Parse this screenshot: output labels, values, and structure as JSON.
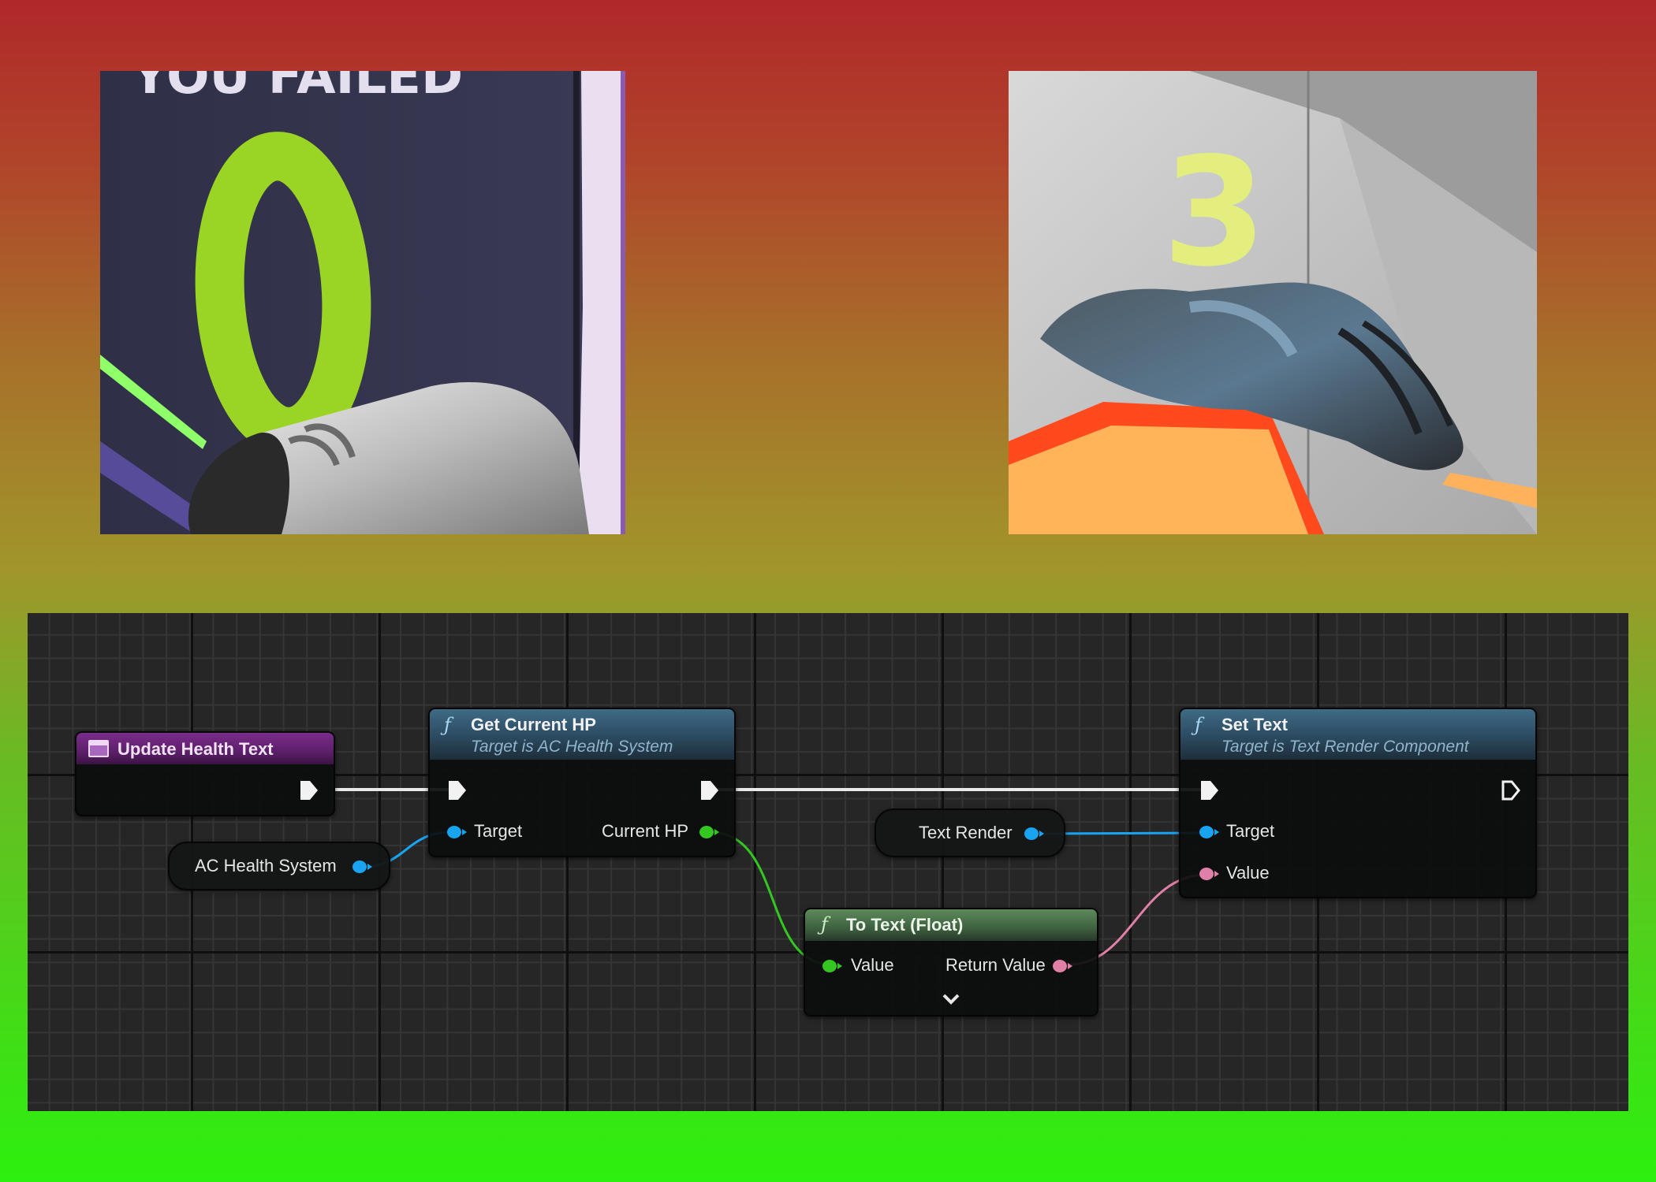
{
  "screenshots": {
    "left": {
      "number_shown": "0",
      "sign_text": "YOU FAILED"
    },
    "right": {
      "number_shown": "3"
    }
  },
  "graph": {
    "event_node": {
      "title": "Update Health Text"
    },
    "variables": [
      {
        "label": "AC Health System",
        "pin": "blue"
      },
      {
        "label": "Text Render",
        "pin": "blue"
      }
    ],
    "get_hp_node": {
      "title": "Get Current HP",
      "subtitle": "Target is AC Health System",
      "input_pin": "Target",
      "output_pin": "Current HP"
    },
    "to_text_node": {
      "title": "To Text (Float)",
      "input_pin": "Value",
      "output_pin": "Return Value"
    },
    "set_text_node": {
      "title": "Set Text",
      "subtitle": "Target is Text Render Component",
      "input_target": "Target",
      "input_value": "Value"
    }
  },
  "colors": {
    "object_pin": "#19a4f1",
    "float_pin": "#35c721",
    "text_pin": "#e07fa8",
    "event_header": "#7b2c8c",
    "function_header": "#3f6b86",
    "pure_function_header": "#5e8a5a"
  }
}
